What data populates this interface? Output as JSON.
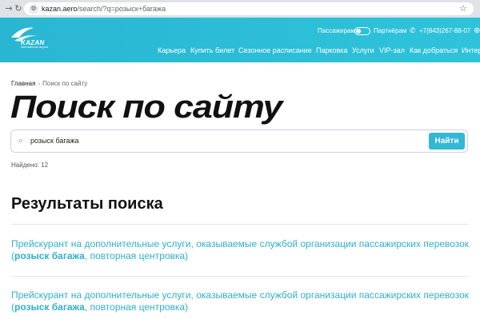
{
  "browser": {
    "url_domain": "kazan.aero",
    "url_path": "/search/?q=розыск+багажа"
  },
  "header": {
    "logo_text": "KAZAN",
    "logo_subtext": "international airport",
    "passengers": "Пассажирам",
    "partners": "Партнёрам",
    "phone": "+7(843)267-88-07",
    "nav": [
      "Карьера",
      "Купить билет",
      "Сезонное расписание",
      "Парковка",
      "Услуги",
      "VIP-зал",
      "Как добраться",
      "Интер"
    ]
  },
  "breadcrumb": {
    "home": "Главная",
    "separator": "›",
    "current": "Поиск по сайту"
  },
  "page_title": "Поиск по сайту",
  "search": {
    "value": "розыск багажа",
    "button": "Найти"
  },
  "found_count": "Найдено: 12",
  "results_title": "Результаты поиска",
  "results": [
    {
      "line1": "Прейскурант на дополнительные услуги, оказываемые службой организации пассажирских",
      "prefix": "перевозок (",
      "highlight": "розыск багажа",
      "suffix": ", повторная центровка)"
    },
    {
      "line1": "Прейскурант на дополнительные услуги, оказываемые службой организации пассажирских",
      "prefix": "перевозок (",
      "highlight": "розыск багажа",
      "suffix": ", повторная центровка)"
    }
  ],
  "colors": {
    "header": "#2fc3db",
    "accent": "#31b8d4",
    "link": "#2fb0cd"
  }
}
